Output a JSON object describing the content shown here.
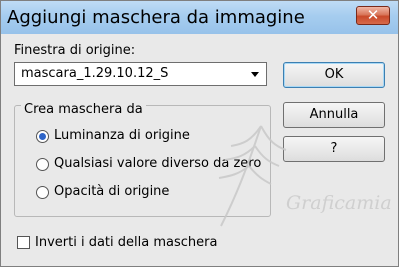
{
  "window": {
    "title": "Aggiungi maschera da immagine"
  },
  "source": {
    "label": "Finestra di origine:",
    "selected": "mascara_1.29.10.12_S"
  },
  "buttons": {
    "ok": "OK",
    "cancel": "Annulla",
    "help": "?"
  },
  "mask_group": {
    "legend": "Crea maschera da",
    "options": [
      {
        "label": "Luminanza di origine",
        "checked": true
      },
      {
        "label": "Qualsiasi valore diverso da zero",
        "checked": false
      },
      {
        "label": "Opacità di origine",
        "checked": false
      }
    ]
  },
  "invert": {
    "label": "Inverti i dati della maschera",
    "checked": false
  },
  "watermark": {
    "text": "Graficamia"
  }
}
